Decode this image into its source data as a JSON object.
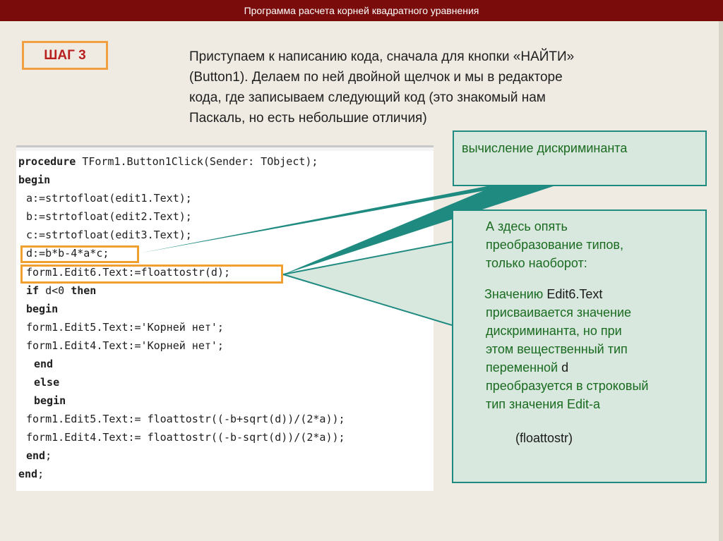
{
  "title": "Программа расчета корней квадратного уравнения",
  "step": {
    "label": "ШАГ 3"
  },
  "intro": {
    "lines": [
      "Приступаем к написанию кода, сначала для кнопки «НАЙТИ»",
      "(Button1). Делаем по ней двойной щелчок и мы в редакторе",
      "кода, где записываем следующий код (это знакомый нам",
      "Паскаль, но есть небольшие отличия)"
    ]
  },
  "code": {
    "lines": [
      "procedure TForm1.Button1Click(Sender: TObject);",
      "begin",
      " a:=strtofloat(edit1.Text);",
      " b:=strtofloat(edit2.Text);",
      " c:=strtofloat(edit3.Text);",
      " d:=b*b-4*a*c;",
      " form1.Edit6.Text:=floattostr(d);",
      " if d<0 then",
      " begin",
      " form1.Edit5.Text:='Корней нет';",
      " form1.Edit4.Text:='Корней нет';",
      "  end",
      "  else",
      "  begin",
      " form1.Edit5.Text:= floattostr((-b+sqrt(d))/(2*a));",
      " form1.Edit4.Text:= floattostr((-b-sqrt(d))/(2*a));",
      " end;",
      "end;"
    ]
  },
  "callout1": {
    "text": "вычисление дискриминанта"
  },
  "callout2": {
    "para1": [
      "А здесь опять",
      "преобразование типов,",
      "только наоборот:"
    ],
    "para2_first_prefix": "Значению ",
    "para2_first_code": "Edit6.Text",
    "para2": [
      "присваивается значение",
      "дискриминанта, но при",
      "этом вещественный тип"
    ],
    "para2_var_prefix": "переменной ",
    "para2_var_code": "d",
    "para2_rest": [
      "преобразуется в строковый",
      "тип значения Edit-a"
    ],
    "func": "(floattostr)"
  },
  "colors": {
    "titlebar": "#7a0c0c",
    "accent_orange": "#f0a030",
    "callout_border": "#1f8a80",
    "callout_fill": "#d8e8df",
    "callout_text": "#1a6b20",
    "step_text": "#b82020"
  }
}
